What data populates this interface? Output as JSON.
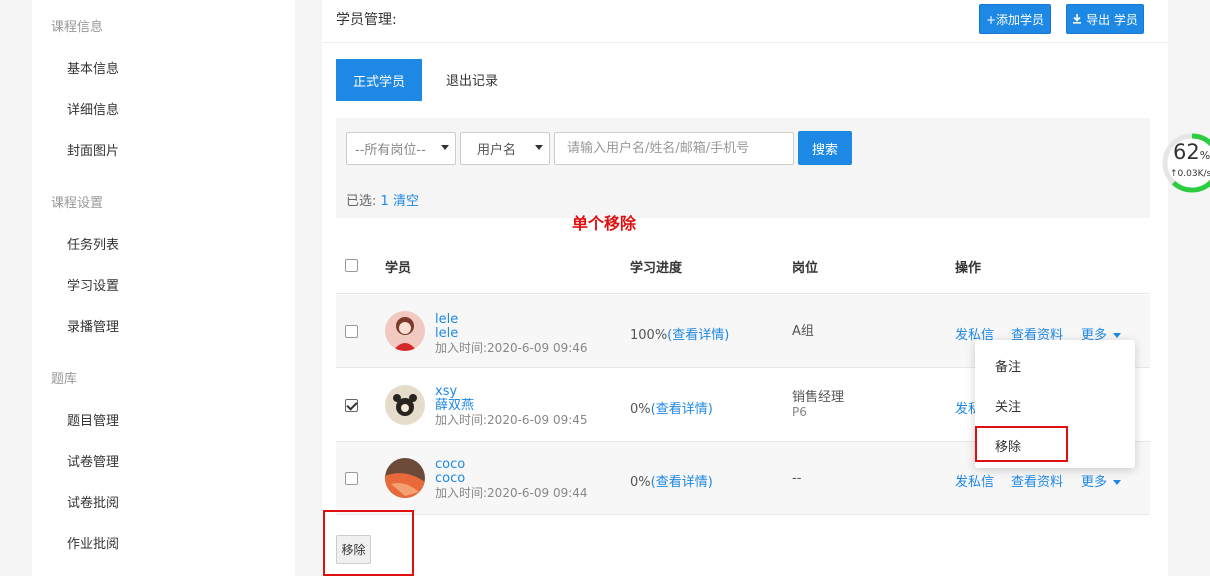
{
  "sidebar": {
    "groups": [
      {
        "title": "课程信息",
        "items": [
          "基本信息",
          "详细信息",
          "封面图片"
        ]
      },
      {
        "title": "课程设置",
        "items": [
          "任务列表",
          "学习设置",
          "录播管理"
        ]
      },
      {
        "title": "题库",
        "items": [
          "题目管理",
          "试卷管理",
          "试卷批阅",
          "作业批阅"
        ]
      }
    ]
  },
  "header": {
    "title": "学员管理:",
    "add_button": "+添加学员",
    "export_button": "导出 学员"
  },
  "tabs": {
    "active": "正式学员",
    "other": "退出记录"
  },
  "filters": {
    "role_select": "--所有岗位--",
    "field_select": "用户名",
    "search_placeholder": "请输入用户名/姓名/邮箱/手机号",
    "search_button": "搜索",
    "selected_label": "已选:",
    "selected_count": "1",
    "clear_label": "清空"
  },
  "annotation": "单个移除",
  "table": {
    "headers": {
      "student": "学员",
      "progress": "学习进度",
      "role": "岗位",
      "actions": "操作"
    },
    "rows": [
      {
        "checked": false,
        "username": "lele",
        "name": "lele",
        "joined": "加入时间:2020-6-09 09:46",
        "progress": "100%",
        "detail": "(查看详情)",
        "role": "A组",
        "role_sub": ""
      },
      {
        "checked": true,
        "username": "xsy",
        "name": "薛双燕",
        "joined": "加入时间:2020-6-09 09:45",
        "progress": "0%",
        "detail": "(查看详情)",
        "role": "销售经理",
        "role_sub": "P6"
      },
      {
        "checked": false,
        "username": "coco",
        "name": "coco",
        "joined": "加入时间:2020-6-09 09:44",
        "progress": "0%",
        "detail": "(查看详情)",
        "role": "--",
        "role_sub": ""
      }
    ],
    "actions": {
      "message": "发私信",
      "profile": "查看资料",
      "more": "更多",
      "message_cut": "发私"
    }
  },
  "dropdown": {
    "items": [
      "备注",
      "关注",
      "移除"
    ]
  },
  "bottom": {
    "remove_button": "移除"
  },
  "net_widget": {
    "percent": "62",
    "percent_unit": "%",
    "speed": "↑0.03K/s"
  },
  "colors": {
    "accent": "#1e88e5",
    "annotation": "#e01010",
    "widget_ring": "#2ecc40"
  }
}
